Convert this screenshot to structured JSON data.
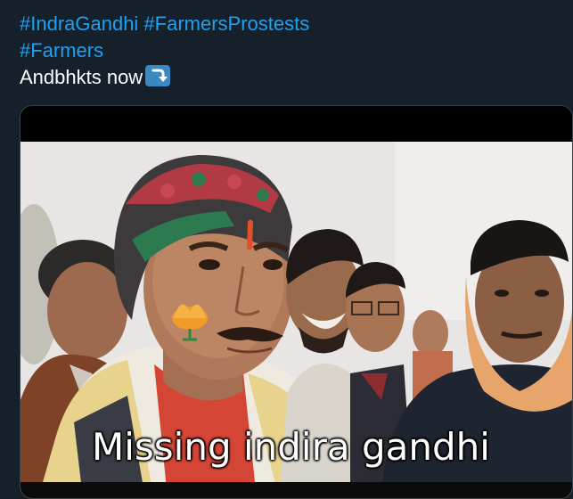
{
  "tweet": {
    "hashtags_line1": "#IndraGandhi #FarmersProstests",
    "hashtags_line2": "#Farmers",
    "text": "Andbhkts now",
    "emoji": "right-arrow-curving-down-emoji"
  },
  "media": {
    "caption": "Missing indira gandhi"
  },
  "colors": {
    "background": "#15202b",
    "hashtag": "#1da1f2",
    "text": "#ffffff",
    "border": "#38444d"
  }
}
